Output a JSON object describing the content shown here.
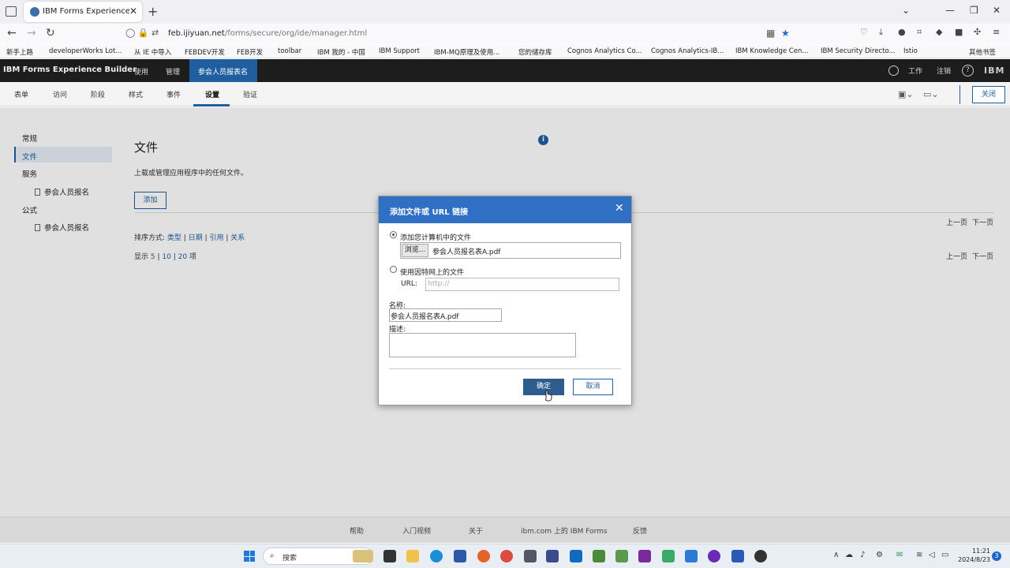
{
  "browser": {
    "tab_title": "IBM Forms Experience Builder",
    "url_domain": "feb.ijiyuan.net",
    "url_path": "/forms/secure/org/ide/manager.html",
    "bookmarks": [
      "新手上路",
      "developerWorks Lot...",
      "从 IE 中导入",
      "FEBDEV开发",
      "FEB开发",
      "toolbar",
      "IBM 我的 - 中国",
      "IBM Support",
      "IBM-MQ原理及使用...",
      "您的储存库",
      "Cognos Analytics Co...",
      "Cognos Analytics-IB...",
      "IBM Knowledge Cen...",
      "IBM Security Directo...",
      "Istio",
      "其他书签"
    ]
  },
  "app": {
    "title": "IBM Forms Experience Builder",
    "nav": [
      "使用",
      "管理"
    ],
    "active_app": "参会人员报表名",
    "right_links": [
      "工作",
      "注销"
    ],
    "logo": "IBM",
    "tabs": [
      "表单",
      "访问",
      "阶段",
      "样式",
      "事件",
      "设置",
      "验证"
    ],
    "close_label": "关闭"
  },
  "sidebar": {
    "items": [
      {
        "label": "常规"
      },
      {
        "label": "文件"
      },
      {
        "label": "服务"
      },
      {
        "label": "参会人员报名"
      },
      {
        "label": "公式"
      },
      {
        "label": "参会人员报名"
      }
    ]
  },
  "content": {
    "title": "文件",
    "description": "上载或管理应用程序中的任何文件。",
    "add_label": "添加",
    "sort_label": "排序方式:",
    "sort_options": [
      "类型",
      "日期",
      "引用",
      "关系"
    ],
    "show_label": "显示",
    "show_options": [
      "5",
      "10",
      "20"
    ],
    "show_suffix": "项",
    "prev": "上一页",
    "next": "下一页"
  },
  "dialog": {
    "title": "添加文件或 URL 链接",
    "option_local": "添加您计算机中的文件",
    "browse_label": "浏览...",
    "file_name": "参会人员报名表A.pdf",
    "option_url": "使用因特网上的文件",
    "url_label": "URL:",
    "url_placeholder": "http://",
    "name_label": "名称:",
    "name_value": "参会人员报名表A.pdf",
    "desc_label": "描述:",
    "ok_label": "确定",
    "cancel_label": "取消"
  },
  "footer": {
    "links": [
      "帮助",
      "入门视频",
      "关于",
      "ibm.com 上的 IBM Forms",
      "反馈"
    ]
  },
  "taskbar": {
    "search_label": "搜索",
    "time": "11:21",
    "date": "2024/8/23",
    "notifications": "3"
  }
}
